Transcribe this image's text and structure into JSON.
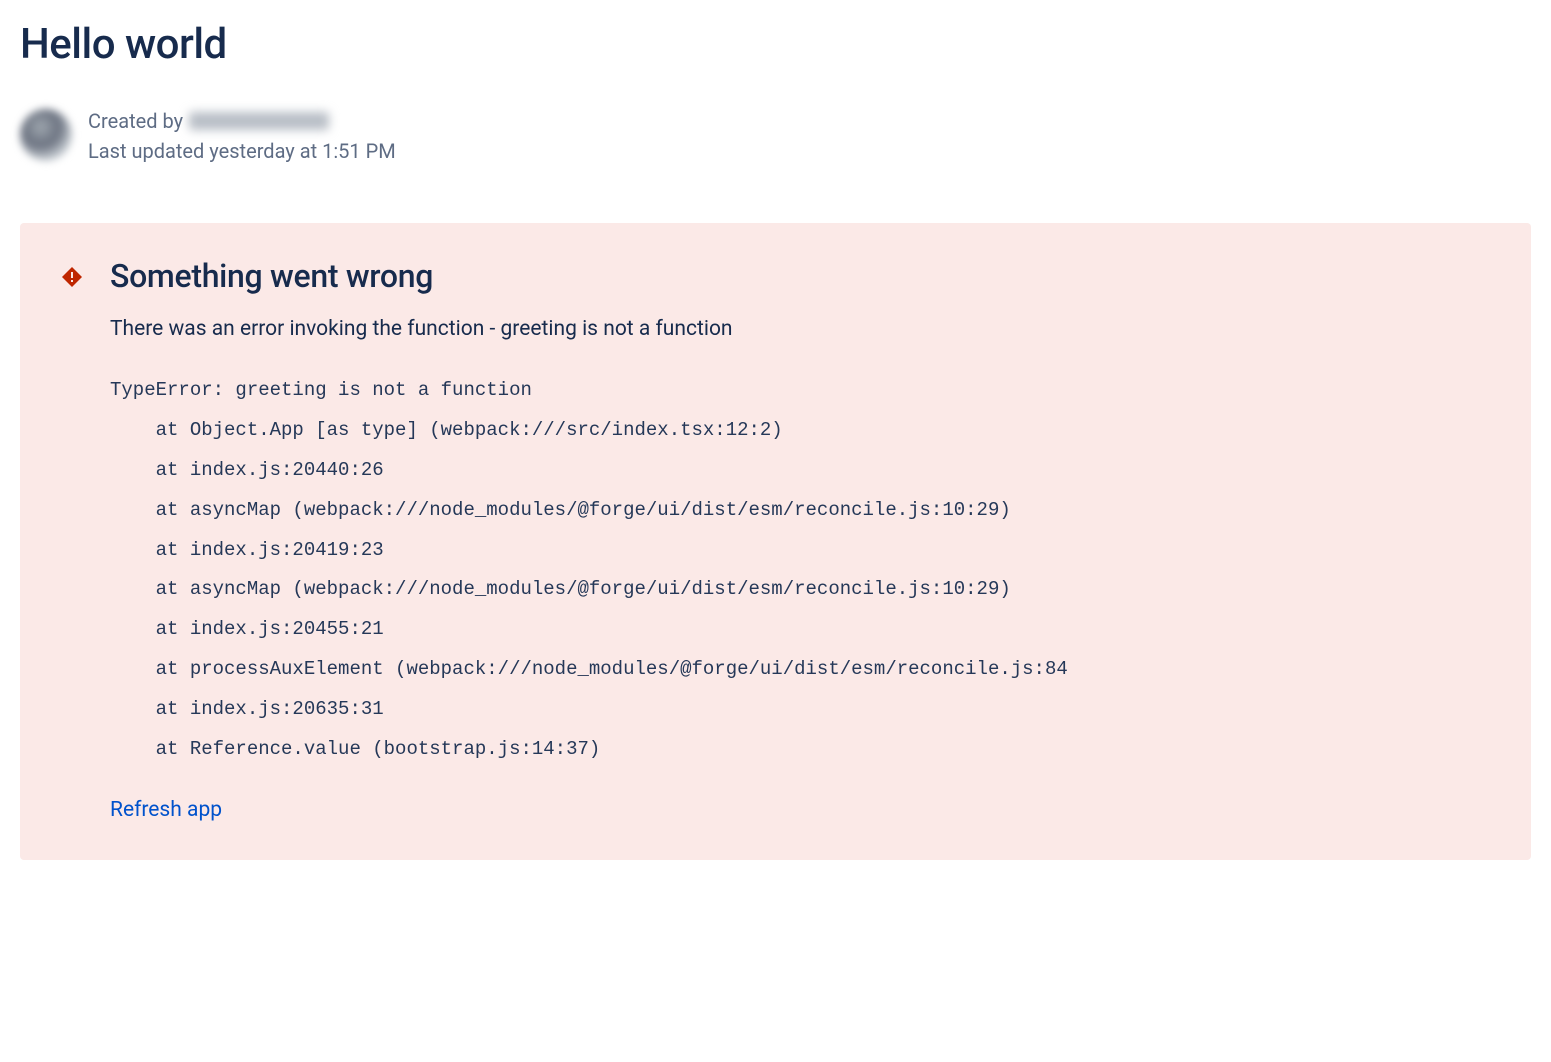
{
  "page": {
    "title": "Hello world"
  },
  "author": {
    "created_by_label": "Created by",
    "last_updated": "Last updated yesterday at 1:51 PM"
  },
  "error": {
    "title": "Something went wrong",
    "description": "There was an error invoking the function - greeting is not a function",
    "stack_trace": "TypeError: greeting is not a function\n    at Object.App [as type] (webpack:///src/index.tsx:12:2)\n    at index.js:20440:26\n    at asyncMap (webpack:///node_modules/@forge/ui/dist/esm/reconcile.js:10:29)\n    at index.js:20419:23\n    at asyncMap (webpack:///node_modules/@forge/ui/dist/esm/reconcile.js:10:29)\n    at index.js:20455:21\n    at processAuxElement (webpack:///node_modules/@forge/ui/dist/esm/reconcile.js:84\n    at index.js:20635:31\n    at Reference.value (bootstrap.js:14:37)",
    "refresh_label": "Refresh app"
  }
}
